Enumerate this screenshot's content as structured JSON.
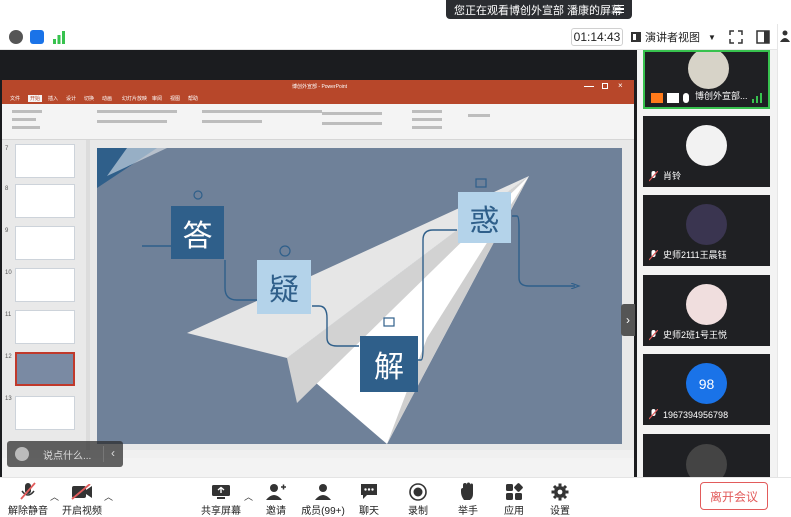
{
  "notice": {
    "text": "您正在观看博创外宣部 潘康的屏幕"
  },
  "statusbar": {
    "timer": "01:14:43",
    "view_label": "演讲者视图"
  },
  "ppt": {
    "title": "博创外宣部 - PowerPoint",
    "tabs": [
      "文件",
      "开始",
      "插入",
      "设计",
      "切换",
      "动画",
      "幻灯片放映",
      "审阅",
      "视图",
      "帮助"
    ],
    "slide_numbers": [
      "7",
      "8",
      "9",
      "10",
      "11",
      "12",
      "13"
    ],
    "chars": {
      "a": "答",
      "b": "疑",
      "c": "解",
      "d": "惑"
    }
  },
  "chat": {
    "placeholder": "说点什么..."
  },
  "participants": [
    {
      "name": "博创外宣部..."
    },
    {
      "name": "肖铃"
    },
    {
      "name": "史师2111王晨钰"
    },
    {
      "name": "史师2班1号王悦"
    },
    {
      "name": "1967394956798",
      "avatar_text": "98"
    }
  ],
  "toolbar": {
    "mute": "解除静音",
    "video": "开启视频",
    "share": "共享屏幕",
    "invite": "邀请",
    "members": "成员(99+)",
    "chat": "聊天",
    "record": "录制",
    "raise": "举手",
    "apps": "应用",
    "settings": "设置",
    "leave": "离开会议"
  },
  "colors": {
    "accent": "#2f5f8a",
    "light": "#b4d3ea",
    "leave": "#e25b5b",
    "active": "#37c24e"
  }
}
